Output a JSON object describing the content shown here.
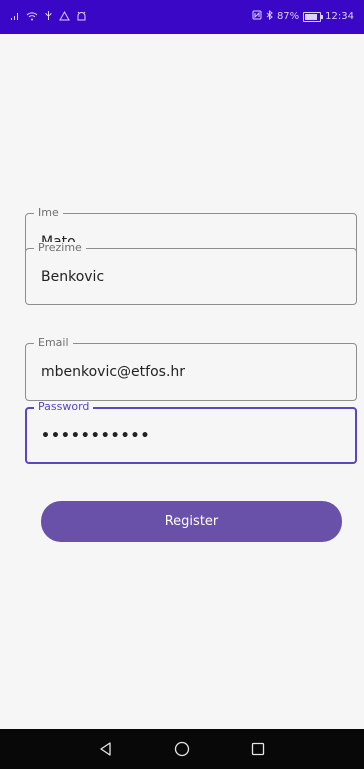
{
  "status_bar": {
    "battery_percent": "87%",
    "time": "12:34",
    "left_icons": [
      "signal-icon",
      "wifi-icon",
      "usb-icon",
      "warning-icon",
      "android-icon"
    ],
    "right_icons": [
      "nfc-icon",
      "bluetooth-icon",
      "battery-icon"
    ]
  },
  "form": {
    "fields": [
      {
        "label": "Ime",
        "value": "Mato",
        "focused": false
      },
      {
        "label": "Prezime",
        "value": "Benkovic",
        "focused": false
      },
      {
        "label": "Email",
        "value": "mbenkovic@etfos.hr",
        "focused": false
      },
      {
        "label": "Password",
        "value": "•••••••••••",
        "focused": true
      }
    ],
    "register_label": "Register"
  },
  "nav": {
    "icons": [
      "back-icon",
      "home-icon",
      "recents-icon"
    ]
  },
  "colors": {
    "status_bar": "#3a07c6",
    "accent": "#5a45c2",
    "button": "#6951aa",
    "background": "#f6f6f6",
    "nav_bar": "#080808"
  }
}
